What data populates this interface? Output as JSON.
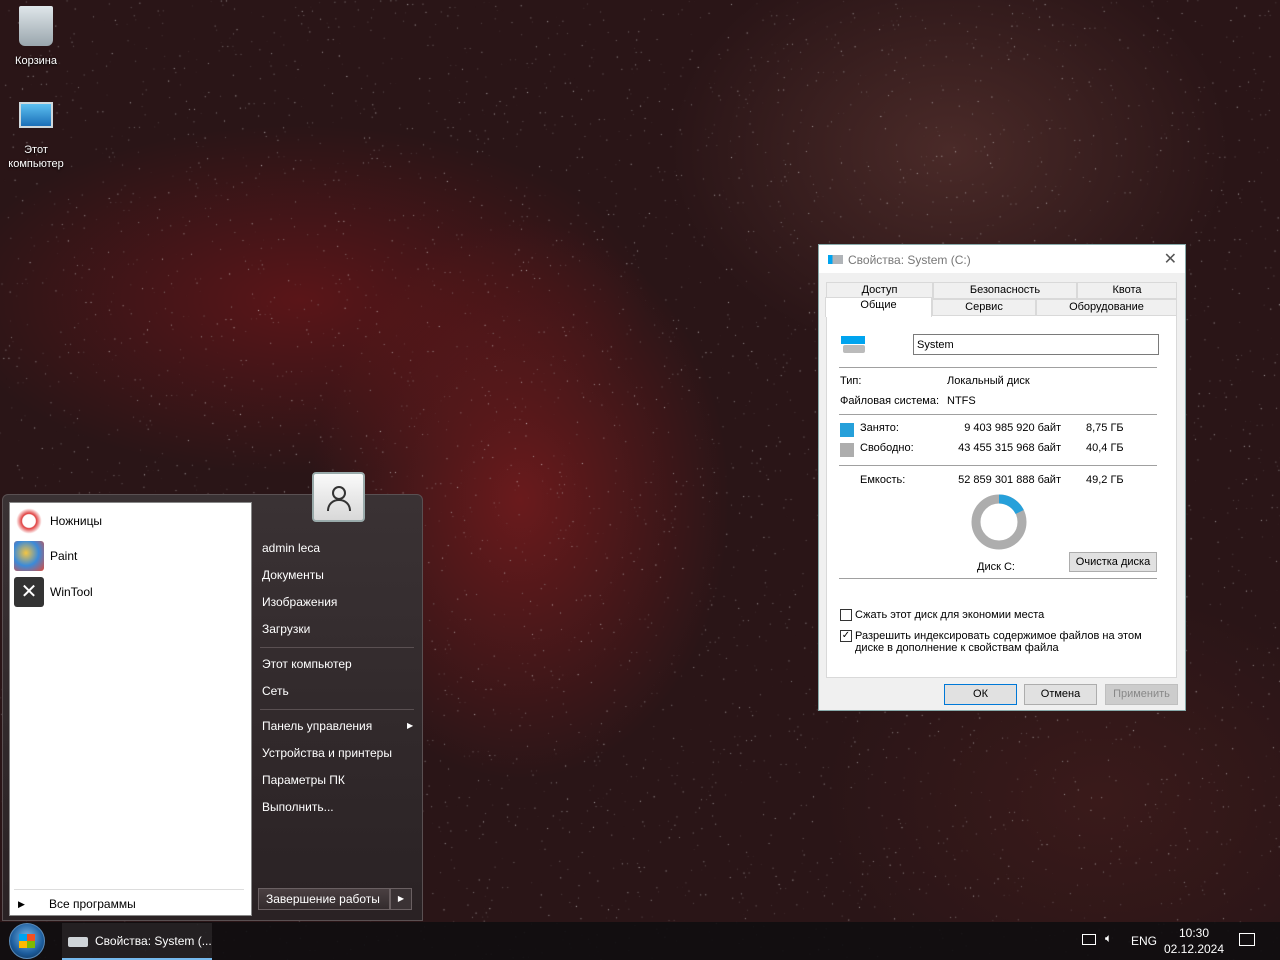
{
  "desktop": {
    "icons": [
      {
        "label": "Корзина",
        "icon": "recycle-bin-icon"
      },
      {
        "label": "Этот компьютер",
        "icon": "computer-icon"
      }
    ]
  },
  "start_menu": {
    "pinned": [
      {
        "label": "Ножницы",
        "icon": "snipping-tool-icon"
      },
      {
        "label": "Paint",
        "icon": "paint-icon"
      },
      {
        "label": "WinTool",
        "icon": "wintool-icon"
      }
    ],
    "all_programs": "Все программы",
    "user": "admin leca",
    "items": [
      "Документы",
      "Изображения",
      "Загрузки",
      "Этот компьютер",
      "Сеть",
      "Панель управления",
      "Устройства и принтеры",
      "Параметры ПК",
      "Выполнить..."
    ],
    "shutdown": "Завершение работы"
  },
  "taskbar": {
    "task": "Свойства: System (...",
    "lang": "ENG",
    "time": "10:30",
    "date": "02.12.2024"
  },
  "dialog": {
    "title": "Свойства: System (C:)",
    "tabs_row1": [
      "Доступ",
      "Безопасность",
      "Квота"
    ],
    "tabs_row2": [
      "Общие",
      "Сервис",
      "Оборудование"
    ],
    "active_tab": "Общие",
    "name_value": "System",
    "type_label": "Тип:",
    "type_value": "Локальный диск",
    "fs_label": "Файловая система:",
    "fs_value": "NTFS",
    "used_label": "Занято:",
    "used_bytes": "9 403 985 920 байт",
    "used_gb": "8,75 ГБ",
    "free_label": "Свободно:",
    "free_bytes": "43 455 315 968 байт",
    "free_gb": "40,4 ГБ",
    "cap_label": "Емкость:",
    "cap_bytes": "52 859 301 888 байт",
    "cap_gb": "49,2 ГБ",
    "used_fraction": 0.178,
    "used_color": "#26a0da",
    "free_color": "#adadad",
    "disk_label": "Диск C:",
    "cleanup": "Очистка диска",
    "compress": {
      "label": "Сжать этот диск для экономии места",
      "checked": false
    },
    "index": {
      "label1": "Разрешить индексировать содержимое файлов на этом",
      "label2": "диске в дополнение к свойствам файла",
      "checked": true
    },
    "ok": "ОК",
    "cancel": "Отмена",
    "apply": "Применить"
  }
}
